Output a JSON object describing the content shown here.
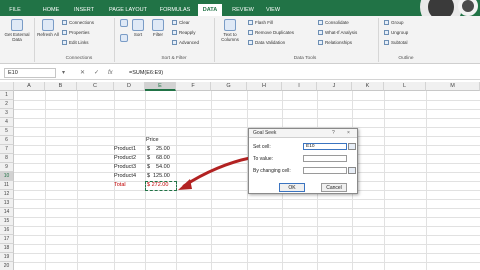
{
  "ribbon_tabs": [
    {
      "label": "FILE"
    },
    {
      "label": "HOME"
    },
    {
      "label": "INSERT"
    },
    {
      "label": "PAGE LAYOUT"
    },
    {
      "label": "FORMULAS"
    },
    {
      "label": "DATA"
    },
    {
      "label": "REVIEW"
    },
    {
      "label": "VIEW"
    }
  ],
  "ribbon": {
    "get_external_data": "Get External Data",
    "refresh_all": "Refresh All",
    "connections": "Connections",
    "properties": "Properties",
    "edit_links": "Edit Links",
    "connections_group": "Connections",
    "sort": "Sort",
    "filter": "Filter",
    "clear": "Clear",
    "reapply": "Reapply",
    "advanced": "Advanced",
    "sort_filter_group": "Sort & Filter",
    "text_to_columns": "Text to Columns",
    "flash_fill": "Flash Fill",
    "remove_duplicates": "Remove Duplicates",
    "data_validation": "Data Validation",
    "consolidate": "Consolidate",
    "what_if_analysis": "What-If Analysis",
    "relationships": "Relationships",
    "data_tools_group": "Data Tools",
    "group": "Group",
    "ungroup": "Ungroup",
    "subtotal": "Subtotal",
    "outline_group": "Outline"
  },
  "formula_bar": {
    "name_box": "E10",
    "formula": "=SUM(E6:E9)"
  },
  "columns": [
    "A",
    "B",
    "C",
    "D",
    "E",
    "F",
    "G",
    "H",
    "I",
    "J",
    "K",
    "L",
    "M"
  ],
  "rows": [
    "1",
    "2",
    "3",
    "4",
    "5",
    "6",
    "7",
    "8",
    "9",
    "10",
    "11",
    "12",
    "13",
    "14",
    "15",
    "16",
    "17",
    "18",
    "19",
    "20"
  ],
  "cells": {
    "price_header": "Price",
    "products": [
      {
        "name": "Product1",
        "currency": "$",
        "price": "25.00"
      },
      {
        "name": "Product2",
        "currency": "$",
        "price": "68.00"
      },
      {
        "name": "Product3",
        "currency": "$",
        "price": "54.00"
      },
      {
        "name": "Product4",
        "currency": "$",
        "price": "125.00"
      }
    ],
    "total_label": "Total",
    "total_value": "$ 272.00"
  },
  "goal_seek": {
    "title": "Goal Seek",
    "set_cell_label": "Set cell:",
    "set_cell_value": "E10",
    "to_value_label": "To value:",
    "to_value_value": "",
    "changing_cell_label": "By changing cell:",
    "changing_cell_value": "",
    "help": "?",
    "close": "×",
    "ok": "OK",
    "cancel": "Cancel"
  },
  "colors": {
    "excel_green": "#217346",
    "arrow_red": "#b22222",
    "total_red": "#c00000"
  }
}
